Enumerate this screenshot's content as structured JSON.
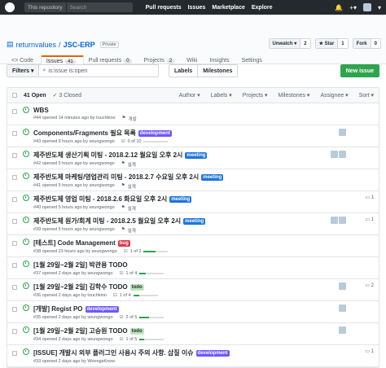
{
  "top": {
    "scope": "This repository",
    "search": "Search",
    "nav": [
      "Pull requests",
      "Issues",
      "Marketplace",
      "Explore"
    ],
    "bell": "🔔",
    "plus": "+▾",
    "avatar_caret": "▾"
  },
  "repo": {
    "owner": "returnvalues",
    "name": "JSC-ERP",
    "private": "Private",
    "unwatch": "Unwatch ▾",
    "unwatch_count": "2",
    "star": "★ Star",
    "star_count": "1",
    "fork": "Fork",
    "fork_count": "0"
  },
  "tabs": [
    {
      "label": "<> Code"
    },
    {
      "label": "Issues",
      "count": "41"
    },
    {
      "label": "Pull requests",
      "count": "0"
    },
    {
      "label": "Projects",
      "count": "2"
    },
    {
      "label": "Wiki"
    },
    {
      "label": "Insights"
    },
    {
      "label": "Settings"
    }
  ],
  "toolbar": {
    "filters": "Filters ▾",
    "query": "is:issue is:open",
    "labels": "Labels",
    "milestones": "Milestones",
    "new_issue": "New issue"
  },
  "list_header": {
    "open": "41 Open",
    "closed": "✓ 3 Closed",
    "filters": [
      "Author ▾",
      "Labels ▾",
      "Projects ▾",
      "Milestones ▾",
      "Assignee ▾",
      "Sort ▾"
    ]
  },
  "issues": [
    {
      "title": "WBS",
      "label": "",
      "label_color": "",
      "meta": "#44 opened 14 minutes ago by touchkino",
      "ms": "개발",
      "progress": "",
      "assignees": 0,
      "comments": ""
    },
    {
      "title": "Components/Fragments 필요 목록",
      "label": "development",
      "label_color": "#7057ff",
      "meta": "#43 opened 9 hours ago by seungwongo",
      "ms": "0 of 10",
      "progress": "0",
      "assignees": 1,
      "comments": ""
    },
    {
      "title": "제주반도체 생산기획 미팅 - 2018.2.12 월요일 오후 2시",
      "label": "meeting",
      "label_color": "#1d76db",
      "meta": "#42 opened 5 hours ago by seungwongo",
      "ms": "설계",
      "progress": "",
      "assignees": 2,
      "comments": ""
    },
    {
      "title": "제주반도체 마케팅/영업관리 미팅 - 2018.2.7 수요일 오후 2시",
      "label": "meeting",
      "label_color": "#1d76db",
      "meta": "#41 opened 5 hours ago by seungwongo",
      "ms": "설계",
      "progress": "",
      "assignees": 0,
      "comments": ""
    },
    {
      "title": "제주반도체 영업 미팅 - 2018.2.6 화요일 오후 2시",
      "label": "meeting",
      "label_color": "#1d76db",
      "meta": "#40 opened 5 hours ago by seungwongo",
      "ms": "설계",
      "progress": "",
      "assignees": 0,
      "comments": "1"
    },
    {
      "title": "제주반도체 원가/회계 미팅 - 2018.2.5 월요일 오후 2시",
      "label": "meeting",
      "label_color": "#1d76db",
      "meta": "#39 opened 5 hours ago by seungwongo",
      "ms": "설계",
      "progress": "",
      "assignees": 2,
      "comments": "1"
    },
    {
      "title": "[테스트] Code Management",
      "label": "bug",
      "label_color": "#d73a4a",
      "meta": "#38 opened 23 hours ago by seungwongo",
      "ms": "1 of 2",
      "progress": "50",
      "assignees": 0,
      "comments": ""
    },
    {
      "title": "[1월 29일~2월 2일] 박관용 TODO",
      "label": "",
      "label_color": "",
      "meta": "#37 opened 2 days ago by seungwongo",
      "ms": "1 of 4",
      "progress": "25",
      "assignees": 0,
      "comments": ""
    },
    {
      "title": "[1월 29일~2월 2일] 김학수 TODO",
      "label": "todo",
      "label_color": "#bfe5bf",
      "meta": "#36 opened 2 days ago by touchkino",
      "ms": "1 of 4",
      "progress": "25",
      "assignees": 1,
      "comments": "2"
    },
    {
      "title": "[개발] Regist PO",
      "label": "development",
      "label_color": "#7057ff",
      "meta": "#35 opened 2 days ago by seungwongo",
      "ms": "2 of 5",
      "progress": "40",
      "assignees": 1,
      "comments": ""
    },
    {
      "title": "[1월 29일~2월 2일] 고승원 TODO",
      "label": "todo",
      "label_color": "#bfe5bf",
      "meta": "#34 opened 2 days ago by seungwongo",
      "ms": "1 of 5",
      "progress": "20",
      "assignees": 1,
      "comments": ""
    },
    {
      "title": "[ISSUE] 개발시 외부 플러그인 사용시 주의 사항. 삽질 이슈",
      "label": "development",
      "label_color": "#7057ff",
      "meta": "#33 opened 2 days ago by WoongsKnow",
      "ms": "",
      "progress": "",
      "assignees": 0,
      "comments": "1"
    }
  ]
}
